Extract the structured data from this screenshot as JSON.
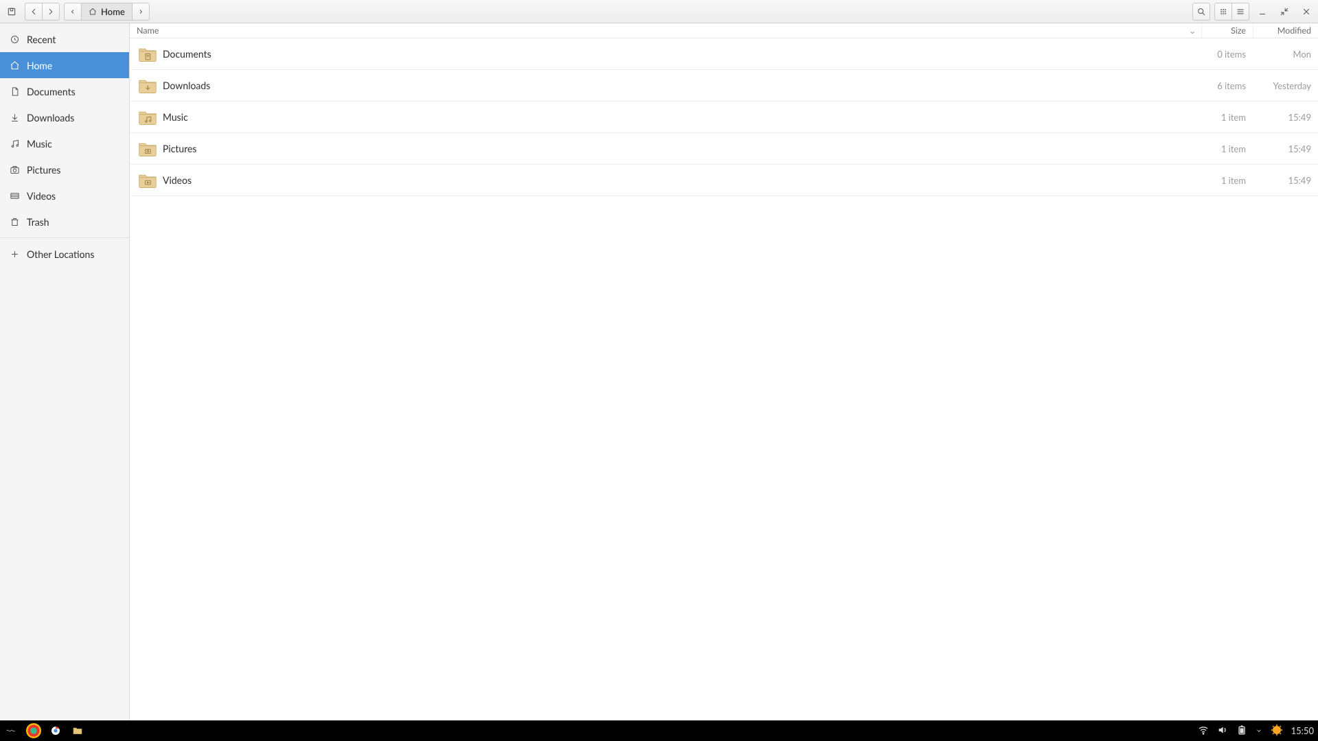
{
  "path": {
    "current": "Home"
  },
  "columns": {
    "name": "Name",
    "size": "Size",
    "modified": "Modified"
  },
  "sidebar": {
    "items": [
      {
        "key": "recent",
        "label": "Recent"
      },
      {
        "key": "home",
        "label": "Home"
      },
      {
        "key": "documents",
        "label": "Documents"
      },
      {
        "key": "downloads",
        "label": "Downloads"
      },
      {
        "key": "music",
        "label": "Music"
      },
      {
        "key": "pictures",
        "label": "Pictures"
      },
      {
        "key": "videos",
        "label": "Videos"
      },
      {
        "key": "trash",
        "label": "Trash"
      }
    ],
    "other": "Other Locations"
  },
  "files": [
    {
      "name": "Documents",
      "kind": "documents",
      "size": "0 items",
      "modified": "Mon"
    },
    {
      "name": "Downloads",
      "kind": "downloads",
      "size": "6 items",
      "modified": "Yesterday"
    },
    {
      "name": "Music",
      "kind": "music",
      "size": "1 item",
      "modified": "15:49"
    },
    {
      "name": "Pictures",
      "kind": "pictures",
      "size": "1 item",
      "modified": "15:49"
    },
    {
      "name": "Videos",
      "kind": "videos",
      "size": "1 item",
      "modified": "15:49"
    }
  ],
  "taskbar": {
    "clock": "15:50"
  }
}
